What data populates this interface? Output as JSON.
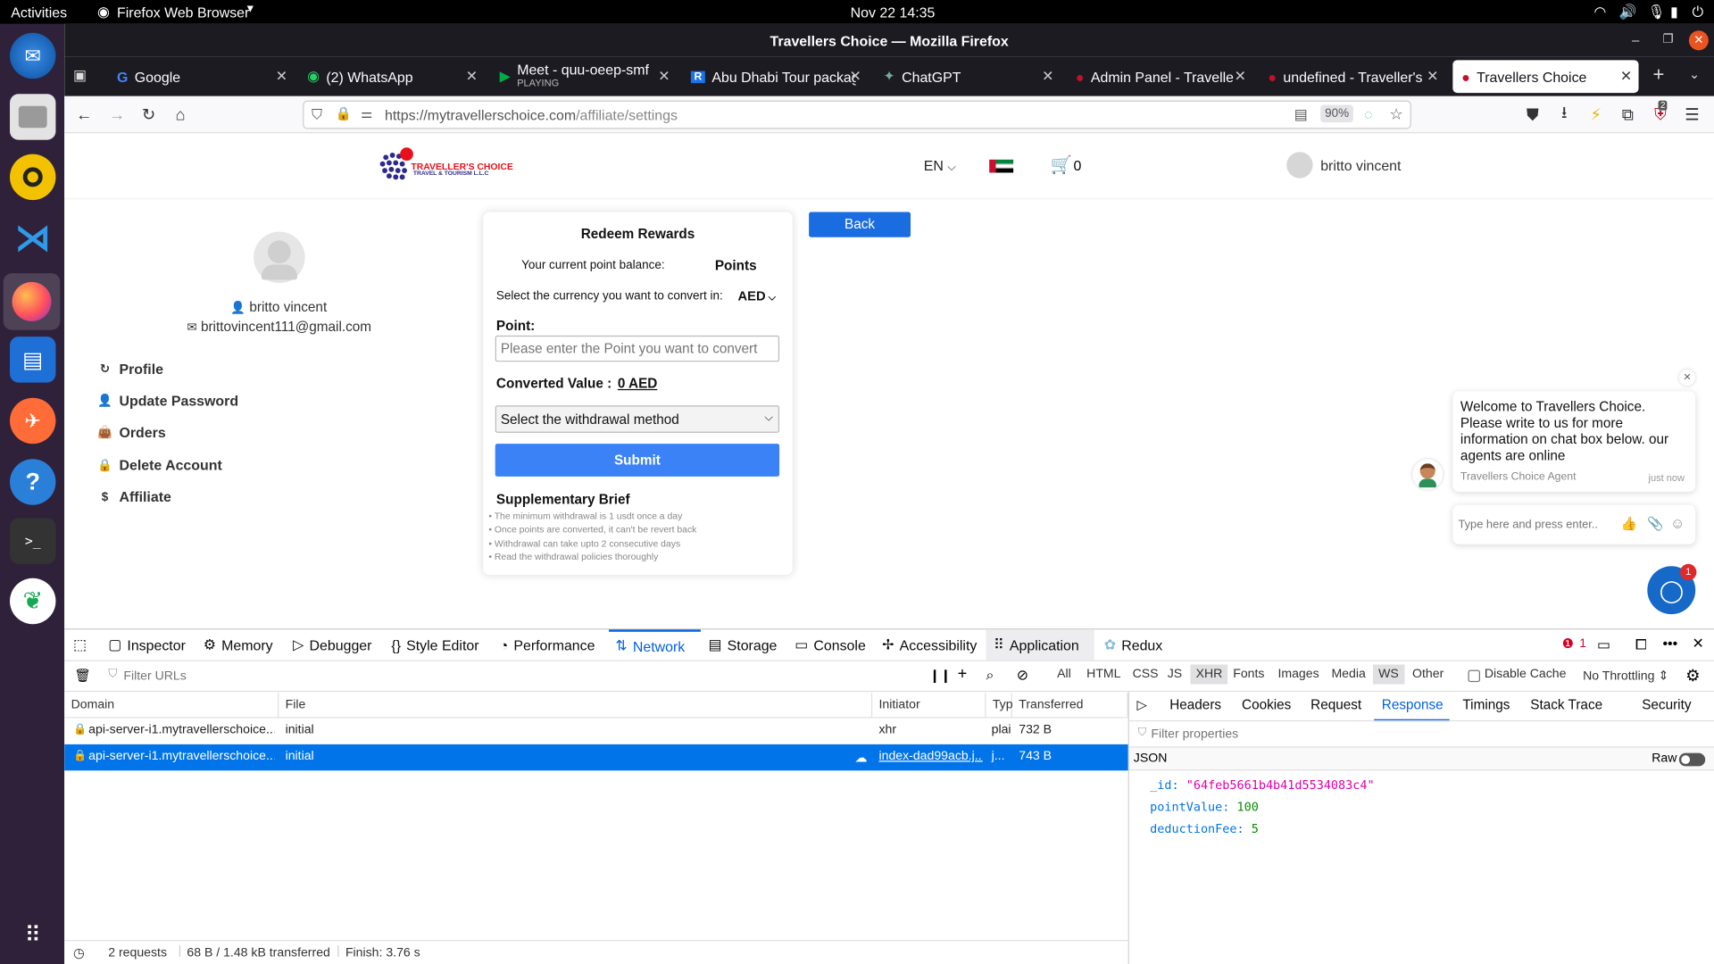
{
  "gnome": {
    "activities": "Activities",
    "app": "Firefox Web Browser",
    "clock": "Nov 22  14:35"
  },
  "window": {
    "title": "Travellers Choice — Mozilla Firefox"
  },
  "tabs": [
    {
      "label": "Google"
    },
    {
      "label": "(2) WhatsApp"
    },
    {
      "label": "Meet - quu-oeep-smf",
      "sub": "PLAYING"
    },
    {
      "label": "Abu Dhabi Tour package"
    },
    {
      "label": "ChatGPT"
    },
    {
      "label": "Admin Panel - Travellers"
    },
    {
      "label": "undefined - Traveller's C"
    },
    {
      "label": "Travellers Choice"
    }
  ],
  "nav": {
    "url_host": "https://mytravellerschoice.com",
    "url_path": "/affiliate/settings",
    "zoom": "90%",
    "notif_count": "2"
  },
  "site": {
    "logo_title": "TRAVELLER'S CHOICE",
    "logo_sub": "TRAVEL & TOURISM L.L.C",
    "lang": "EN",
    "cart_count": "0",
    "user_name": "britto vincent",
    "profile_name": "britto vincent",
    "profile_email": "brittovincent111@gmail.com",
    "menu": [
      "Profile",
      "Update Password",
      "Orders",
      "Delete Account",
      "Affiliate"
    ],
    "back": "Back"
  },
  "redeem": {
    "title": "Redeem Rewards",
    "balance_label": "Your current point balance:",
    "balance_value": "Points",
    "currency_label": "Select the currency you want to convert in:",
    "currency": "AED",
    "point_label": "Point:",
    "point_placeholder": "Please enter the Point you want to convert",
    "converted_label": "Converted Value :",
    "converted_value": "0 AED",
    "withdraw_placeholder": "Select the withdrawal method",
    "submit": "Submit",
    "brief_title": "Supplementary Brief",
    "brief": [
      "The minimum withdrawal is 1 usdt once a day",
      "Once points are converted, it can't be revert back",
      "Withdrawal can take upto 2 consecutive days",
      "Read the withdrawal policies thoroughly"
    ]
  },
  "chat": {
    "message": "Welcome to Travellers Choice. Please write to us for more information on chat box below. our agents are online",
    "agent": "Travellers Choice Agent",
    "time": "just now",
    "placeholder": "Type here and press enter..",
    "badge": "1"
  },
  "devtools": {
    "tabs": [
      "Inspector",
      "Memory",
      "Debugger",
      "Style Editor",
      "Performance",
      "Network",
      "Storage",
      "Console",
      "Accessibility",
      "Application",
      "Redux"
    ],
    "error_count": "1",
    "filter_placeholder": "Filter URLs",
    "filters": [
      "All",
      "HTML",
      "CSS",
      "JS",
      "XHR",
      "Fonts",
      "Images",
      "Media",
      "WS",
      "Other"
    ],
    "disable_cache": "Disable Cache",
    "throttle": "No Throttling",
    "columns": [
      "Domain",
      "File",
      "Initiator",
      "Typ",
      "Transferred"
    ],
    "rows": [
      {
        "domain": "api-server-i1.mytravellerschoice....",
        "file": "initial",
        "initiator": "xhr",
        "type": "plai",
        "size": "732 B"
      },
      {
        "domain": "api-server-i1.mytravellerschoice....",
        "file": "initial",
        "initiator": "index-dad99acb.j...",
        "type": "j...",
        "size": "743 B"
      }
    ],
    "status": {
      "requests": "2 requests",
      "transferred": "68 B / 1.48 kB transferred",
      "finish": "Finish: 3.76 s"
    },
    "detail_tabs": [
      "Headers",
      "Cookies",
      "Request",
      "Response",
      "Timings",
      "Stack Trace",
      "Security"
    ],
    "filter_props": "Filter properties",
    "json_label": "JSON",
    "raw_label": "Raw",
    "json": [
      {
        "key": "_id:",
        "value": "\"64feb5661b4b41d5534083c4\""
      },
      {
        "key": "pointValue:",
        "value": "100"
      },
      {
        "key": "deductionFee:",
        "value": "5"
      }
    ]
  }
}
